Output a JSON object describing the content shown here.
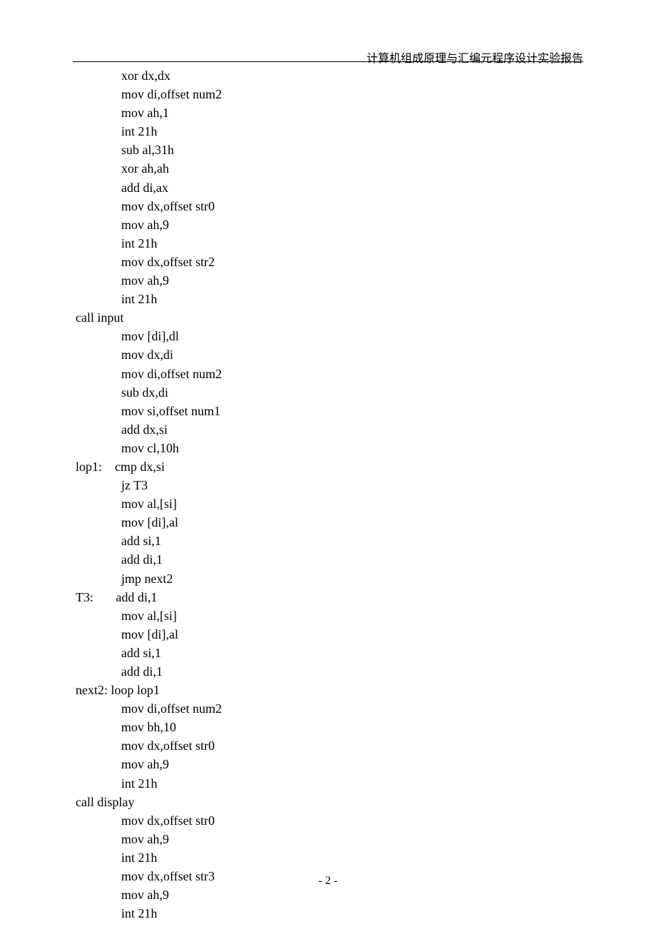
{
  "header": "计算机组成原理与汇编元程序设计实验报告",
  "pageNumber": "- 2 -",
  "code": {
    "lines": [
      {
        "indent": 1,
        "text": "xor dx,dx"
      },
      {
        "indent": 1,
        "text": "mov di,offset num2"
      },
      {
        "indent": 1,
        "text": "mov ah,1"
      },
      {
        "indent": 1,
        "text": "int 21h"
      },
      {
        "indent": 1,
        "text": "sub al,31h"
      },
      {
        "indent": 1,
        "text": "xor ah,ah"
      },
      {
        "indent": 1,
        "text": "add di,ax"
      },
      {
        "indent": 1,
        "text": "mov dx,offset str0"
      },
      {
        "indent": 1,
        "text": "mov ah,9"
      },
      {
        "indent": 1,
        "text": "int 21h"
      },
      {
        "indent": 1,
        "text": "mov dx,offset str2"
      },
      {
        "indent": 1,
        "text": "mov ah,9"
      },
      {
        "indent": 1,
        "text": "int 21h"
      },
      {
        "indent": 0,
        "text": "call input"
      },
      {
        "indent": 1,
        "text": "mov [di],dl"
      },
      {
        "indent": 1,
        "text": "mov dx,di"
      },
      {
        "indent": 1,
        "text": "mov di,offset num2"
      },
      {
        "indent": 1,
        "text": "sub dx,di"
      },
      {
        "indent": 1,
        "text": "mov si,offset num1"
      },
      {
        "indent": 1,
        "text": "add dx,si"
      },
      {
        "indent": 1,
        "text": "mov cl,10h"
      },
      {
        "indent": 0,
        "text": "lop1:    cmp dx,si"
      },
      {
        "indent": 1,
        "text": "jz T3"
      },
      {
        "indent": 1,
        "text": "mov al,[si]"
      },
      {
        "indent": 1,
        "text": "mov [di],al"
      },
      {
        "indent": 1,
        "text": "add si,1"
      },
      {
        "indent": 1,
        "text": "add di,1"
      },
      {
        "indent": 1,
        "text": "jmp next2"
      },
      {
        "indent": 0,
        "text": "T3:       add di,1"
      },
      {
        "indent": 1,
        "text": "mov al,[si]"
      },
      {
        "indent": 1,
        "text": "mov [di],al"
      },
      {
        "indent": 1,
        "text": "add si,1"
      },
      {
        "indent": 1,
        "text": "add di,1"
      },
      {
        "indent": 0,
        "text": "next2: loop lop1"
      },
      {
        "indent": 1,
        "text": "mov di,offset num2"
      },
      {
        "indent": 1,
        "text": "mov bh,10"
      },
      {
        "indent": 1,
        "text": "mov dx,offset str0"
      },
      {
        "indent": 1,
        "text": "mov ah,9"
      },
      {
        "indent": 1,
        "text": "int 21h"
      },
      {
        "indent": 0,
        "text": "call display"
      },
      {
        "indent": 1,
        "text": "mov dx,offset str0"
      },
      {
        "indent": 1,
        "text": "mov ah,9"
      },
      {
        "indent": 1,
        "text": "int 21h"
      },
      {
        "indent": 1,
        "text": "mov dx,offset str3"
      },
      {
        "indent": 1,
        "text": "mov ah,9"
      },
      {
        "indent": 1,
        "text": "int 21h"
      }
    ]
  }
}
